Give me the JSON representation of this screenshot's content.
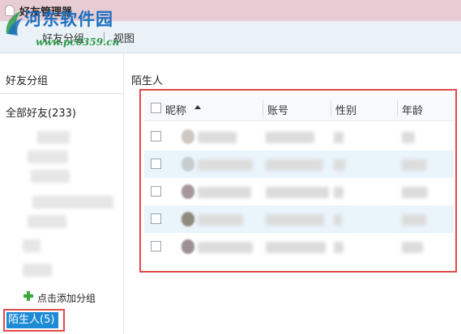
{
  "window": {
    "title": "好友管理器"
  },
  "toolbar": {
    "friend_group": "好友分组",
    "view": "视图"
  },
  "watermark": {
    "site_name": "河东软件园",
    "url": "www.pc0359.cn"
  },
  "sidebar": {
    "header": "好友分组",
    "all_friends": "全部好友(233)",
    "add_group": "点击添加分组",
    "stranger_group": "陌生人(5)"
  },
  "main": {
    "group_title": "陌生人",
    "columns": [
      "昵称",
      "账号",
      "性别",
      "年龄"
    ],
    "row_count": 5
  },
  "colors": {
    "title_bar": "#e8ccd4",
    "toolbar": "#eaf2f7",
    "highlight_border": "#e04a4a",
    "selected_group": "#1d8ad6",
    "row_alt": "#eaf4fb"
  }
}
